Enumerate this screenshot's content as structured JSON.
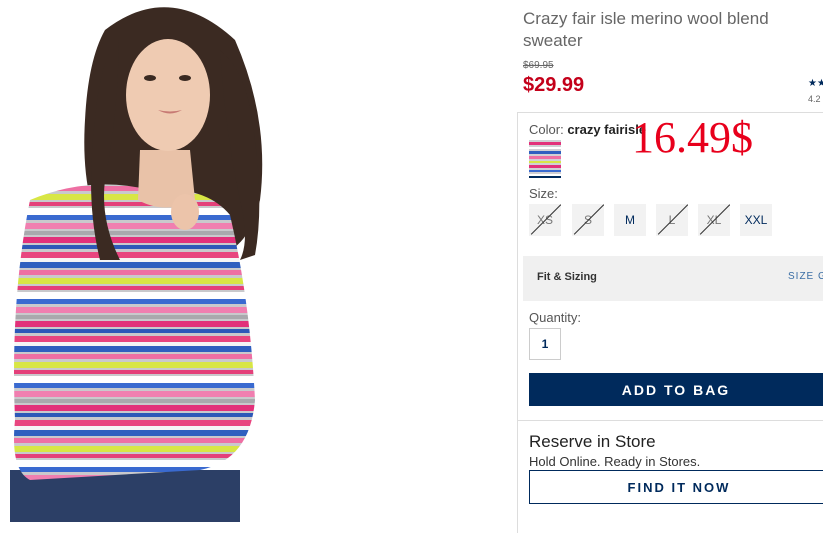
{
  "product": {
    "title": "Crazy fair isle merino wool blend sweater",
    "old_price": "$69.95",
    "price": "$29.99",
    "rating_stars": "★★",
    "rating_value": "4.2"
  },
  "color": {
    "label": "Color:",
    "value": "crazy fairisle"
  },
  "annotation": "16.49$",
  "size": {
    "label": "Size:",
    "options": [
      {
        "label": "XS",
        "available": false
      },
      {
        "label": "S",
        "available": false
      },
      {
        "label": "M",
        "available": true
      },
      {
        "label": "L",
        "available": false
      },
      {
        "label": "XL",
        "available": false
      },
      {
        "label": "XXL",
        "available": true
      }
    ]
  },
  "fit": {
    "label": "Fit & Sizing",
    "guide": "SIZE GUIDE"
  },
  "quantity": {
    "label": "Quantity:",
    "value": "1"
  },
  "add_to_bag": "ADD TO BAG",
  "reserve": {
    "title": "Reserve in Store",
    "subtitle": "Hold Online. Ready in Stores.",
    "button": "FIND IT NOW"
  },
  "colors": {
    "price_red": "#c4001a",
    "navy": "#002a5c",
    "annotation_red": "#e8001c"
  }
}
